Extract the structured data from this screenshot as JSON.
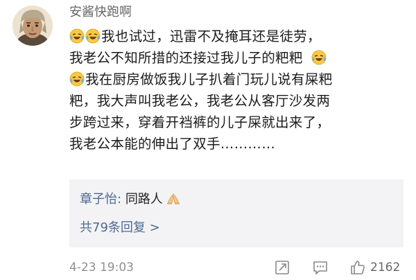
{
  "comment": {
    "username": "安酱快跑啊",
    "avatar_icon": "avatar-man-headscarf",
    "lines": [
      "我也试过，迅雷不及掩耳还是徒劳，",
      "我老公不知所措的还接过我儿子的粑粑",
      "我在厨房做饭我儿子扒着门玩儿说有屎粑",
      "粑，我大声叫我老公，我老公从客厅沙发两",
      "步跨过来，穿着开裆裤的儿子屎就出来了，",
      "我老公本能的伸出了双手…………"
    ],
    "emoji_icon": "laughing-crying-emoji"
  },
  "reply_preview": {
    "username": "章子怡:",
    "text": "同路人",
    "emoji_icon": "folded-hands-emoji",
    "more_label": "共79条回复 >"
  },
  "footer": {
    "timestamp": "4-23 19:03",
    "likes": "2162",
    "icons": [
      "share-icon",
      "comment-icon",
      "thumbs-up-icon"
    ]
  },
  "colors": {
    "link_blue": "#4d6a92",
    "username_gray": "#666666",
    "timestamp_gray": "#909090",
    "reply_bg": "#f3f3f5",
    "icon_gray": "#888888"
  }
}
